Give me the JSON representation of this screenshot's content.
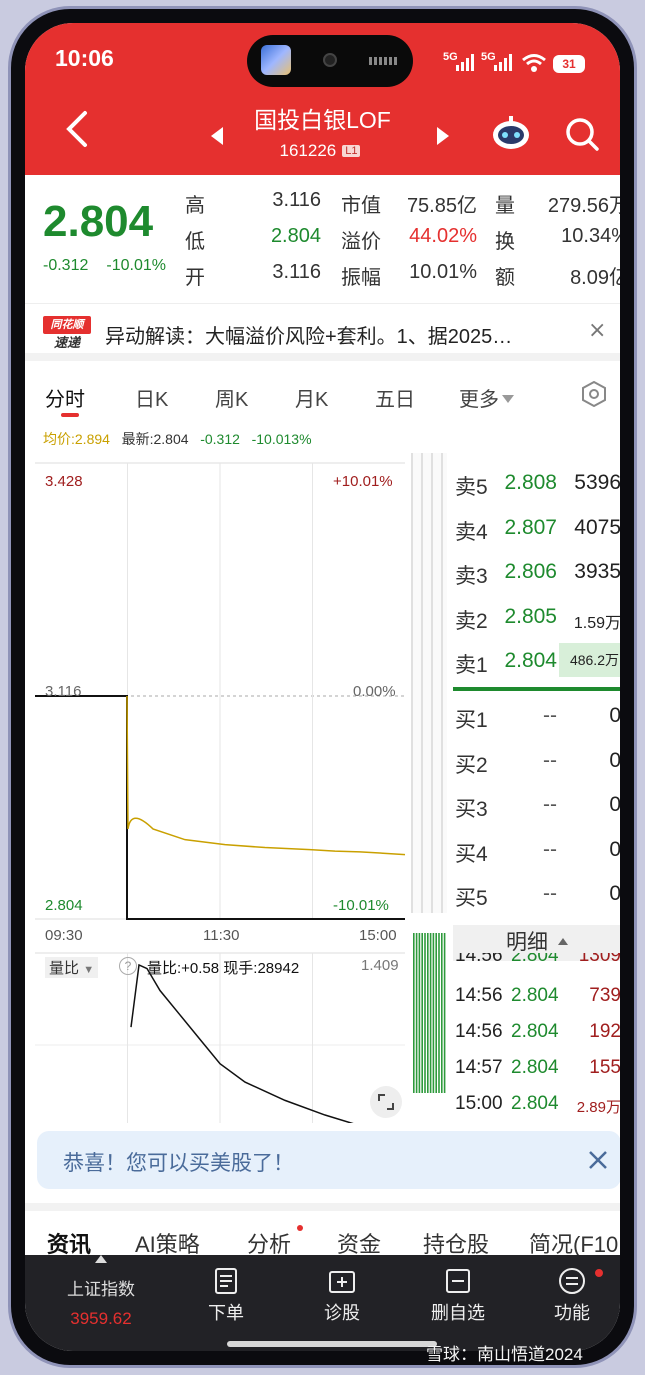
{
  "status": {
    "time": "10:06",
    "signal1": "5G",
    "signal2": "5G",
    "battery": "31"
  },
  "header": {
    "title": "国投白银LOF",
    "code": "161226",
    "level_tag": "L1"
  },
  "quote": {
    "price": "2.804",
    "change": "-0.312",
    "change_pct": "-10.01%",
    "rows": [
      {
        "l1": "高",
        "v1": "3.116",
        "l2": "市值",
        "v2": "75.85亿",
        "l3": "量",
        "v3": "279.56万"
      },
      {
        "l1": "低",
        "v1": "2.804",
        "l2": "溢价",
        "v2": "44.02%",
        "l3": "换",
        "v3": "10.34%"
      },
      {
        "l1": "开",
        "v1": "3.116",
        "l2": "振幅",
        "v2": "10.01%",
        "l3": "额",
        "v3": "8.09亿"
      }
    ]
  },
  "news": {
    "logo_top": "同花顺",
    "logo_bottom": "速递",
    "text": "异动解读：大幅溢价风险+套利。1、据2025…",
    "close": "×"
  },
  "tabs": [
    "分时",
    "日K",
    "周K",
    "月K",
    "五日",
    "更多"
  ],
  "avgline": {
    "avg": "均价:2.894",
    "latest": "最新:2.804",
    "chg": "-0.312",
    "pct": "-10.013%"
  },
  "chart": {
    "y_top": "3.428",
    "y_mid": "3.116",
    "y_bot": "2.804",
    "pct_top": "+10.01%",
    "pct_mid": "0.00%",
    "pct_bot": "-10.01%",
    "times": [
      "09:30",
      "11:30",
      "15:00"
    ],
    "vol_selector": "量比",
    "vol_info": "量比:+0.58   现手:28942",
    "vol_max": "1.409"
  },
  "chart_data": {
    "type": "line",
    "x": [
      "09:30",
      "09:31",
      "09:33",
      "09:40",
      "10:00",
      "10:30",
      "11:00",
      "11:30",
      "13:30",
      "14:00",
      "14:30",
      "15:00"
    ],
    "series": [
      {
        "values": [
          3.116,
          2.804,
          2.804,
          2.804,
          2.804,
          2.804,
          2.804,
          2.804,
          2.804,
          2.804,
          2.804,
          2.804
        ]
      },
      {
        "name": "均价",
        "values": [
          3.116,
          3.116,
          2.96,
          2.93,
          2.915,
          2.908,
          2.904,
          2.901,
          2.899,
          2.898,
          2.896,
          2.894
        ]
      }
    ],
    "volume_ratio": [
      0.9,
      1.409,
      1.38,
      1.2,
      1.0,
      0.8,
      0.6,
      0.45,
      0.3,
      0.18,
      0.08,
      0.02
    ],
    "ylim": [
      2.804,
      3.428
    ],
    "yticks": [
      "3.428",
      "3.116",
      "2.804"
    ],
    "xticks": [
      "09:30",
      "11:30",
      "15:00"
    ],
    "grid": true
  },
  "book": {
    "asks": [
      {
        "label": "卖5",
        "price": "2.808",
        "vol": "5396"
      },
      {
        "label": "卖4",
        "price": "2.807",
        "vol": "4075"
      },
      {
        "label": "卖3",
        "price": "2.806",
        "vol": "3935"
      },
      {
        "label": "卖2",
        "price": "2.805",
        "vol": "1.59万"
      },
      {
        "label": "卖1",
        "price": "2.804",
        "vol": "486.2万"
      }
    ],
    "bids": [
      {
        "label": "买1",
        "price": "--",
        "vol": "0"
      },
      {
        "label": "买2",
        "price": "--",
        "vol": "0"
      },
      {
        "label": "买3",
        "price": "--",
        "vol": "0"
      },
      {
        "label": "买4",
        "price": "--",
        "vol": "0"
      },
      {
        "label": "买5",
        "price": "--",
        "vol": "0"
      }
    ]
  },
  "detail": {
    "header": "明细",
    "rows": [
      {
        "t": "14:56",
        "p": "2.804",
        "v": "1309"
      },
      {
        "t": "14:56",
        "p": "2.804",
        "v": "739"
      },
      {
        "t": "14:56",
        "p": "2.804",
        "v": "192"
      },
      {
        "t": "14:57",
        "p": "2.804",
        "v": "155"
      },
      {
        "t": "15:00",
        "p": "2.804",
        "v": "2.89万"
      }
    ]
  },
  "promo": {
    "text": "恭喜！您可以买美股了！"
  },
  "bottom_tabs": [
    "资讯",
    "AI策略",
    "分析",
    "资金",
    "持仓股",
    "简况(F10"
  ],
  "nav": {
    "index_name": "上证指数",
    "index_value": "3959.62",
    "items": [
      "下单",
      "诊股",
      "删自选",
      "功能"
    ]
  },
  "watermark": "雪球：南山悟道2024",
  "colors": {
    "header_red": "#e5302f",
    "down_green": "#1e8a2e",
    "avg_gold": "#c9a000"
  }
}
